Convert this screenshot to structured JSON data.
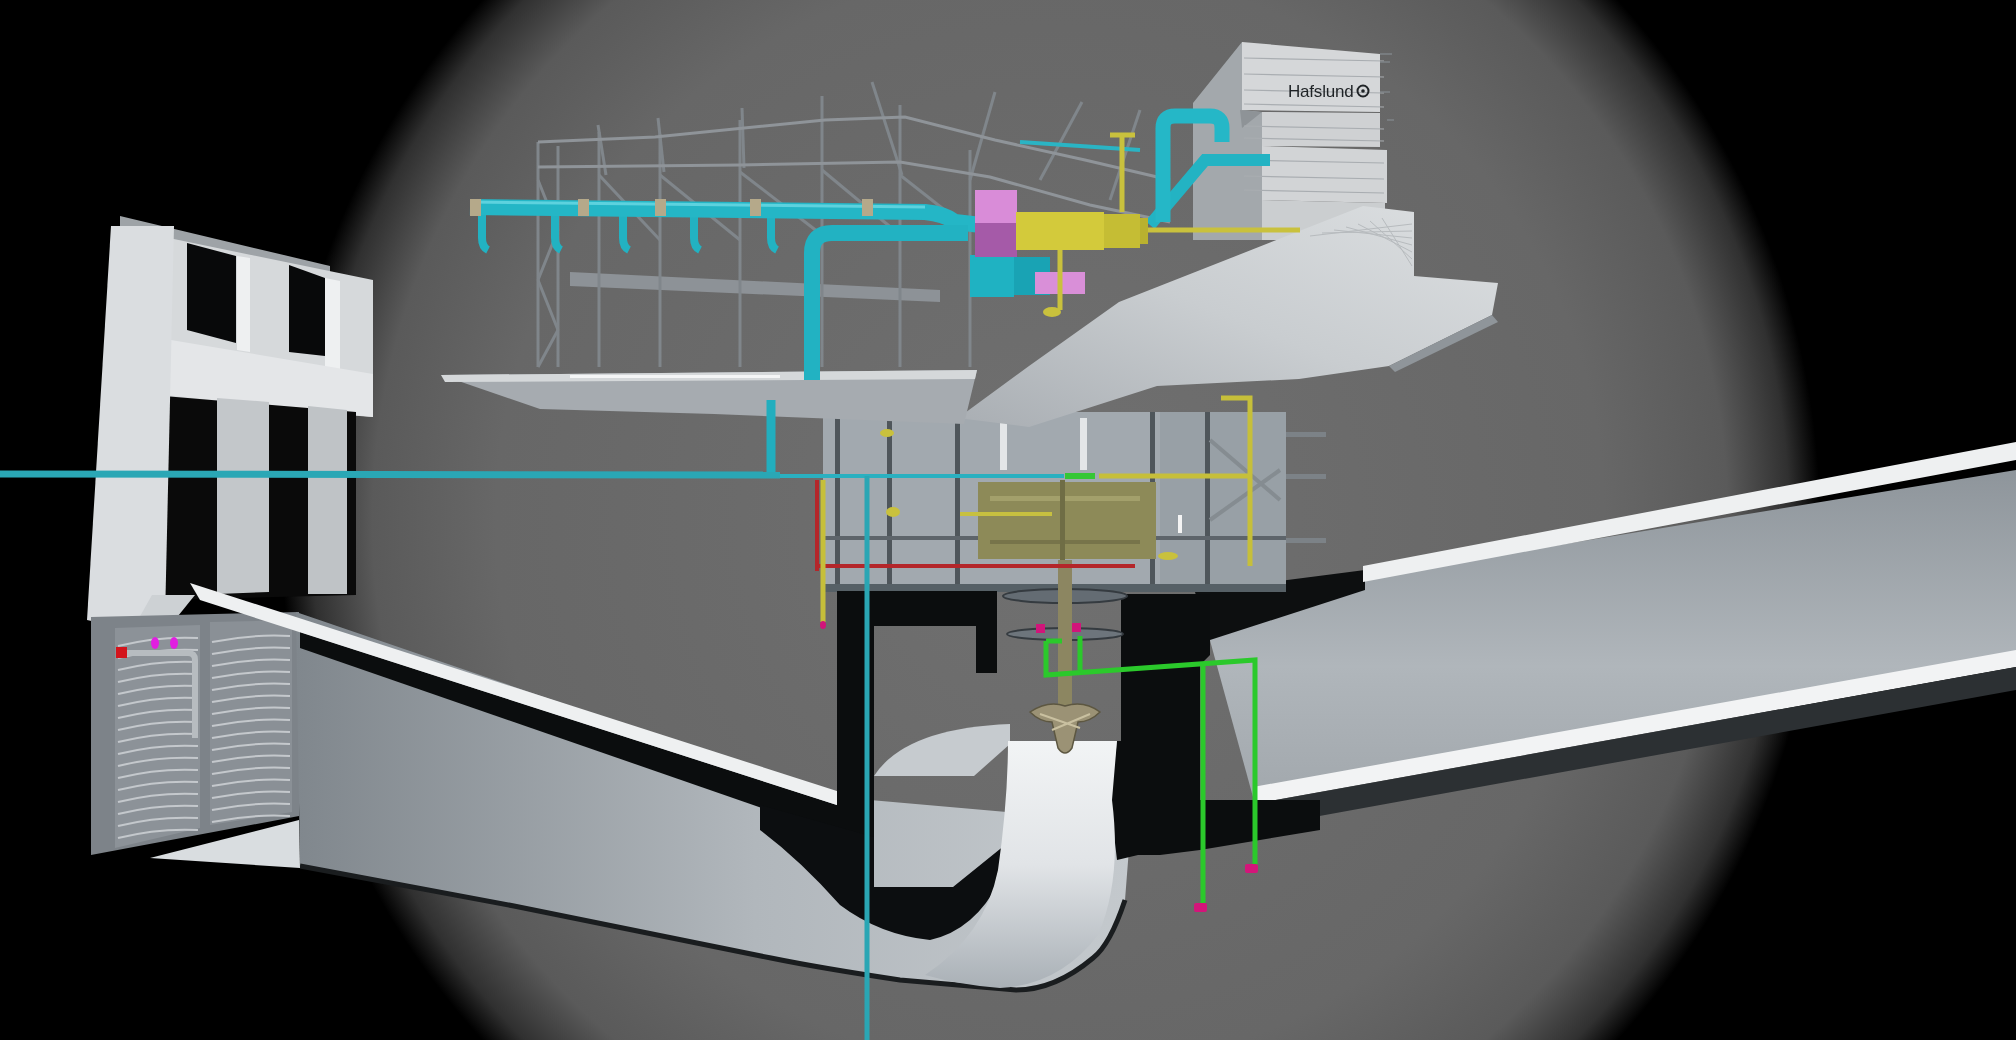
{
  "tower": {
    "sign": "Hafslund"
  }
}
